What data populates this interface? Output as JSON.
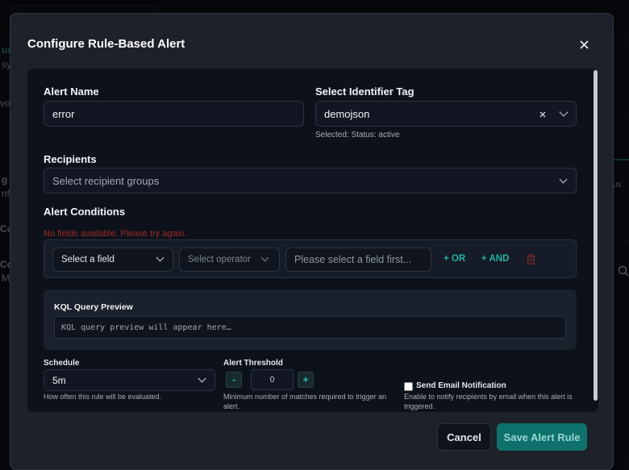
{
  "modal": {
    "title": "Configure Rule-Based Alert",
    "close_icon": "close-icon"
  },
  "form": {
    "alert_name": {
      "label": "Alert Name",
      "value": "error"
    },
    "identifier_tag": {
      "label": "Select Identifier Tag",
      "value": "demojson",
      "selected_note": "Selected: Status: active"
    },
    "recipients": {
      "label": "Recipients",
      "placeholder": "Select recipient groups"
    },
    "conditions": {
      "label": "Alert Conditions",
      "error": "No fields available. Please try again.",
      "field_placeholder": "Select a field",
      "operator_placeholder": "Select operator",
      "value_placeholder": "Please select a field first...",
      "or_label": "+ OR",
      "and_label": "+ AND"
    },
    "kql": {
      "title": "KQL Query Preview",
      "placeholder": "KQL query preview will appear here…"
    },
    "schedule": {
      "label": "Schedule",
      "value": "5m",
      "help": "How often this rule will be evaluated."
    },
    "threshold": {
      "label": "Alert Threshold",
      "value": "0",
      "minus": "-",
      "plus": "+",
      "help_line1": "Minimum number of matches required to trigger an",
      "help_line2": "alert."
    },
    "email": {
      "label": "Send Email Notification",
      "checked": false,
      "help_line1": "Enable to notify recipients by email when this alert is",
      "help_line2": "triggered."
    }
  },
  "footer": {
    "cancel_label": "Cancel",
    "save_label": "Save Alert Rule"
  },
  "background_fragments": {
    "a": "ur",
    "b": "sy",
    "c": "vo",
    "d": "g A",
    "e": "nfi",
    "f": "Co",
    "g": "Co",
    "h": "Ma",
    "i": "us"
  },
  "colors": {
    "accent": "#22b3a4",
    "save_bg": "#0e716b",
    "error": "#9f2a2a",
    "panel": "#0d111a",
    "modal": "#1d212a"
  }
}
